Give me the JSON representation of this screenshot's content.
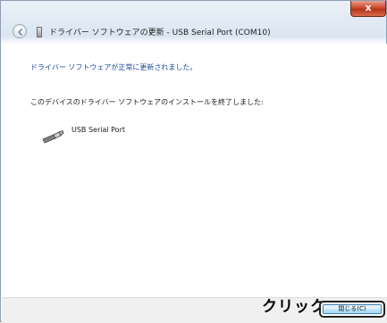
{
  "window": {
    "title": "ドライバー ソフトウェアの更新 - USB Serial Port (COM10)",
    "close_glyph": "x"
  },
  "content": {
    "heading": "ドライバー ソフトウェアが正常に更新されました。",
    "message": "このデバイスのドライバー ソフトウェアのインストールを終了しました:",
    "device_name": "USB Serial Port"
  },
  "annotation": {
    "text": "クリック"
  },
  "footer": {
    "close_button_label": "閉じる(C)"
  },
  "icons": {
    "back": "back-arrow-icon",
    "device_small": "device-icon",
    "usb_device": "usb-connector-icon"
  },
  "colors": {
    "heading": "#1d4a9b",
    "close_button": "#c9462b",
    "annotation": "#000000"
  }
}
